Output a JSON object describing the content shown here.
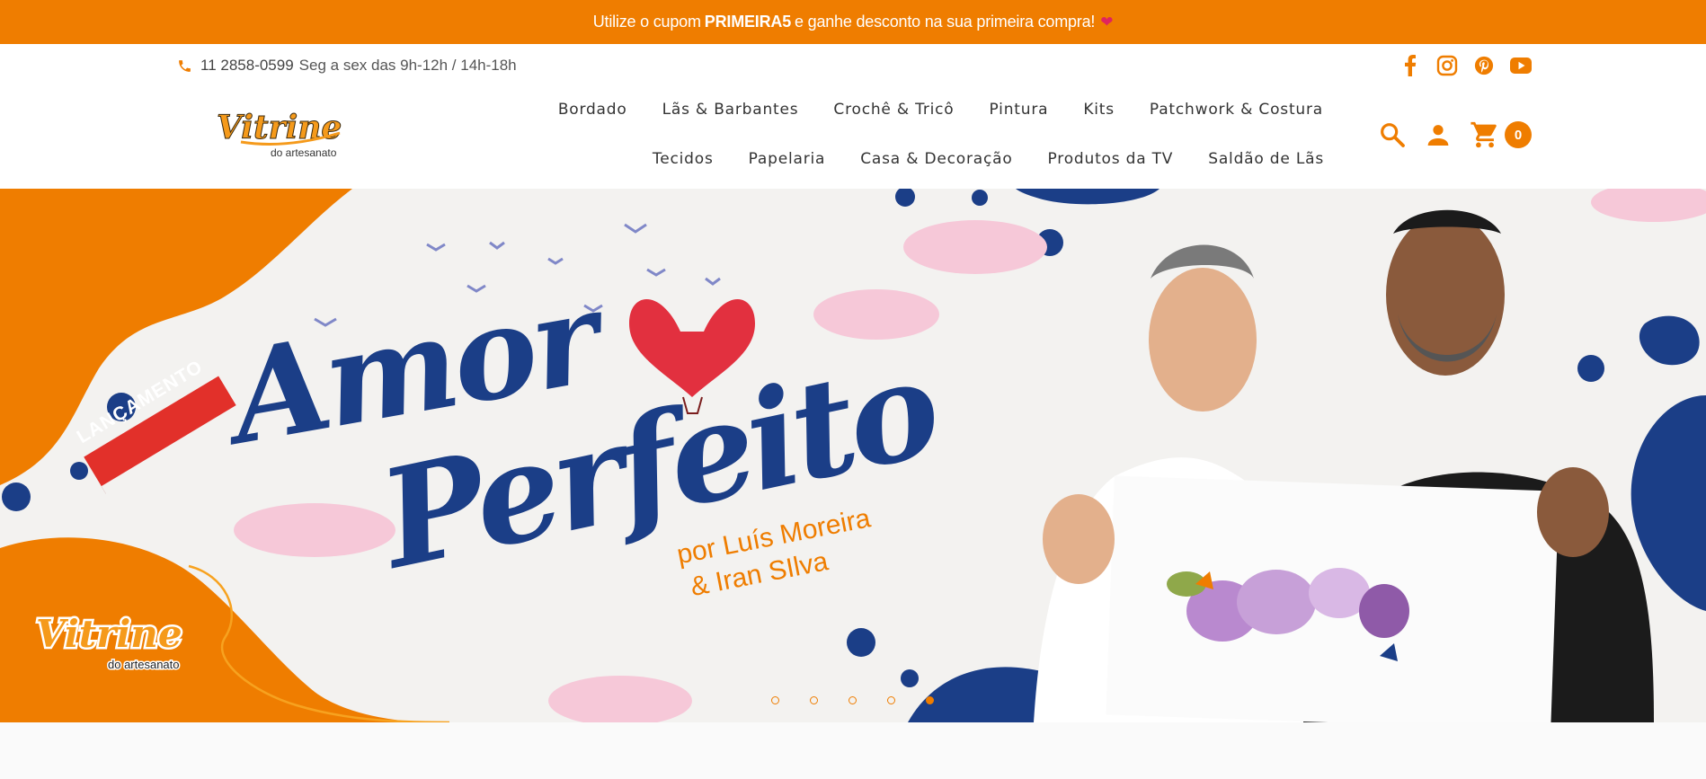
{
  "promo": {
    "prefix": "Utilize o cupom",
    "code": "PRIMEIRA5",
    "suffix": "e ganhe desconto na sua primeira compra!",
    "heart": "❤"
  },
  "contact": {
    "phone": "11 2858-0599",
    "hours": "Seg a sex das 9h-12h / 14h-18h",
    "icon": "phone-icon"
  },
  "social": [
    "facebook-icon",
    "instagram-icon",
    "pinterest-icon",
    "youtube-icon"
  ],
  "logo": {
    "wordmark": "Vitrine",
    "tagline": "do artesanato"
  },
  "nav": {
    "row1": [
      "Bordado",
      "Lãs & Barbantes",
      "Crochê & Tricô",
      "Pintura",
      "Kits",
      "Patchwork & Costura"
    ],
    "row2": [
      "Tecidos",
      "Papelaria",
      "Casa & Decoração",
      "Produtos da TV",
      "Saldão de Lãs"
    ]
  },
  "tools": {
    "search_icon": "search-icon",
    "account_icon": "user-icon",
    "cart_icon": "cart-icon",
    "cart_count": "0"
  },
  "hero": {
    "badge": "LANÇAMENTO",
    "title_line1": "Amor",
    "title_line2": "Perfeito",
    "byline_line1": "por Luís Moreira",
    "byline_line2": "& Iran SIlva",
    "logo_wordmark": "Vitrine",
    "logo_tagline": "do artesanato",
    "slides": 5,
    "active_slide": 5
  },
  "colors": {
    "brand_orange": "#ef7d00",
    "brand_blue": "#1b3e87"
  }
}
